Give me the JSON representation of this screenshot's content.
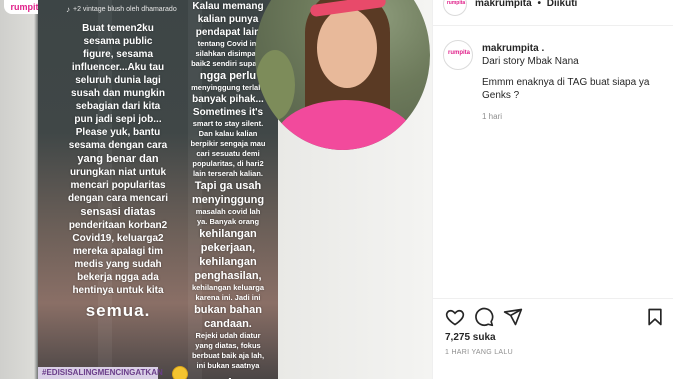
{
  "account": {
    "username": "makrumpita",
    "dot": "•",
    "follow_state": "Diikuti",
    "logo_text": "rumpita"
  },
  "story": {
    "header_text": "+2 vintage blush oleh dhamarado",
    "left_lines": [
      {
        "t": "Buat temen2ku",
        "s": "md"
      },
      {
        "t": "sesama public",
        "s": "md"
      },
      {
        "t": "figure, sesama",
        "s": "md"
      },
      {
        "t": "influencer...Aku tau",
        "s": "md"
      },
      {
        "t": "seluruh dunia lagi",
        "s": "md"
      },
      {
        "t": "susah dan mungkin",
        "s": "md"
      },
      {
        "t": "sebagian dari kita",
        "s": "md"
      },
      {
        "t": "pun jadi sepi job...",
        "s": "md"
      },
      {
        "t": "Please yuk, bantu",
        "s": "md"
      },
      {
        "t": "sesama dengan cara",
        "s": "md"
      },
      {
        "t": "yang benar dan",
        "s": "bold"
      },
      {
        "t": "urungkan niat untuk",
        "s": "md"
      },
      {
        "t": "mencari popularitas",
        "s": "md"
      },
      {
        "t": "dengan cara mencari",
        "s": "md"
      },
      {
        "t": "sensasi diatas",
        "s": "bold"
      },
      {
        "t": "penderitaan korban2",
        "s": "md"
      },
      {
        "t": "Covid19, keluarga2",
        "s": "md"
      },
      {
        "t": "mereka apalagi tim",
        "s": "md"
      },
      {
        "t": "medis yang sudah",
        "s": "md"
      },
      {
        "t": "bekerja ngga ada",
        "s": "md"
      },
      {
        "t": "hentinya untuk kita",
        "s": "md"
      },
      {
        "t": "semua.",
        "s": "lg"
      }
    ],
    "right_lines": [
      {
        "t": "Kalau memang",
        "s": "md"
      },
      {
        "t": "kalian punya",
        "s": "md"
      },
      {
        "t": "pendapat lain",
        "s": "md"
      },
      {
        "t": "tentang Covid ini",
        "s": "sm"
      },
      {
        "t": "silahkan disimpan",
        "s": "sm"
      },
      {
        "t": "baik2 sendiri supaya",
        "s": "sm"
      },
      {
        "t": "ngga perlu",
        "s": "bold"
      },
      {
        "t": "menyinggung terlalu",
        "s": "sm"
      },
      {
        "t": "banyak pihak...",
        "s": "md"
      },
      {
        "t": "Sometimes it's",
        "s": "md"
      },
      {
        "t": "smart to stay silent.",
        "s": "sm"
      },
      {
        "t": "Dan kalau kalian",
        "s": "sm"
      },
      {
        "t": "berpikir sengaja mau",
        "s": "sm"
      },
      {
        "t": "cari sesuatu demi",
        "s": "sm"
      },
      {
        "t": "popularitas, di hari2",
        "s": "sm"
      },
      {
        "t": "lain terserah kalian.",
        "s": "sm"
      },
      {
        "t": "Tapi ga usah",
        "s": "bold"
      },
      {
        "t": "menyinggung",
        "s": "bold"
      },
      {
        "t": "masalah covid lah",
        "s": "sm"
      },
      {
        "t": "ya. Banyak orang",
        "s": "sm"
      },
      {
        "t": "kehilangan",
        "s": "bold"
      },
      {
        "t": "pekerjaan,",
        "s": "bold"
      },
      {
        "t": "kehilangan",
        "s": "bold"
      },
      {
        "t": "penghasilan,",
        "s": "bold"
      },
      {
        "t": "kehilangan keluarga",
        "s": "sm"
      },
      {
        "t": "karena ini. Jadi ini",
        "s": "sm"
      },
      {
        "t": "bukan bahan",
        "s": "bold"
      },
      {
        "t": "candaan.",
        "s": "bold"
      },
      {
        "t": "Rejeki udah diatur",
        "s": "sm"
      },
      {
        "t": "yang diatas, fokus",
        "s": "sm"
      },
      {
        "t": "berbuat baik aja lah,",
        "s": "sm"
      },
      {
        "t": "ini bukan saatnya",
        "s": "sm"
      },
      {
        "t": "egois...",
        "s": "lg2"
      }
    ],
    "hashtag": "#EDISISALINGMENCINGATKAN"
  },
  "comment": {
    "username": "makrumpita .",
    "line1": "Dari story Mbak Nana",
    "line2": "Emmm enaknya di TAG buat siapa ya Genks ?",
    "time": "1 hari"
  },
  "actions": {
    "likes": "7,275 suka",
    "posted": "1 HARI YANG LALU"
  },
  "colors": {
    "brand_pink": "#e0208a",
    "muted": "#8e8e8e",
    "border": "#efefef"
  }
}
